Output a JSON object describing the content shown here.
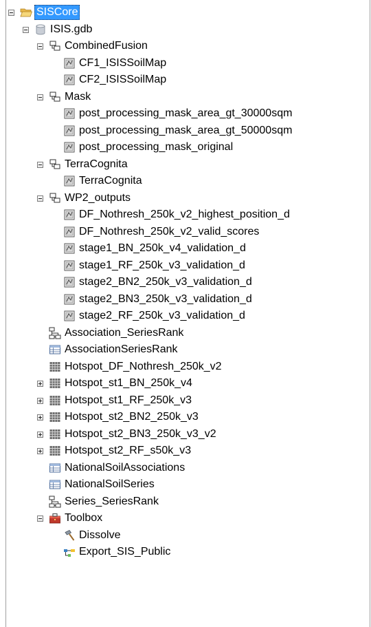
{
  "tree": {
    "root": {
      "label": "SISCore",
      "icon": "open-folder-icon",
      "selected": true
    },
    "gdb": {
      "label": "ISIS.gdb",
      "icon": "geodatabase-icon"
    },
    "datasets": [
      {
        "label": "CombinedFusion",
        "icon": "feature-dataset-icon",
        "children": [
          "CF1_ISISSoilMap",
          "CF2_ISISSoilMap"
        ]
      },
      {
        "label": "Mask",
        "icon": "feature-dataset-icon",
        "children": [
          "post_processing_mask_area_gt_30000sqm",
          "post_processing_mask_area_gt_50000sqm",
          "post_processing_mask_original"
        ]
      },
      {
        "label": "TerraCognita",
        "icon": "feature-dataset-icon",
        "children": [
          "TerraCognita"
        ]
      },
      {
        "label": "WP2_outputs",
        "icon": "feature-dataset-icon",
        "children": [
          "DF_Nothresh_250k_v2_highest_position_d",
          "DF_Nothresh_250k_v2_valid_scores",
          "stage1_BN_250k_v4_validation_d",
          "stage1_RF_250k_v3_validation_d",
          "stage2_BN2_250k_v3_validation_d",
          "stage2_BN3_250k_v3_validation_d",
          "stage2_RF_250k_v3_validation_d"
        ]
      }
    ],
    "items": [
      {
        "label": "Association_SeriesRank",
        "icon": "relationship-class-icon",
        "expander": false
      },
      {
        "label": "AssociationSeriesRank",
        "icon": "table-icon",
        "expander": false
      },
      {
        "label": "Hotspot_DF_Nothresh_250k_v2",
        "icon": "raster-icon",
        "expander": false
      },
      {
        "label": "Hotspot_st1_BN_250k_v4",
        "icon": "raster-icon",
        "expander": true
      },
      {
        "label": "Hotspot_st1_RF_250k_v3",
        "icon": "raster-icon",
        "expander": true
      },
      {
        "label": "Hotspot_st2_BN2_250k_v3",
        "icon": "raster-icon",
        "expander": true
      },
      {
        "label": "Hotspot_st2_BN3_250k_v3_v2",
        "icon": "raster-icon",
        "expander": true
      },
      {
        "label": "Hotspot_st2_RF_s50k_v3",
        "icon": "raster-icon",
        "expander": true
      },
      {
        "label": "NationalSoilAssociations",
        "icon": "table-icon",
        "expander": false
      },
      {
        "label": "NationalSoilSeries",
        "icon": "table-icon",
        "expander": false
      },
      {
        "label": "Series_SeriesRank",
        "icon": "relationship-class-icon",
        "expander": false
      }
    ],
    "toolbox": {
      "label": "Toolbox",
      "icon": "toolbox-icon",
      "children": [
        {
          "label": "Dissolve",
          "icon": "hammer-tool-icon"
        },
        {
          "label": "Export_SIS_Public",
          "icon": "model-tool-icon"
        }
      ]
    }
  }
}
